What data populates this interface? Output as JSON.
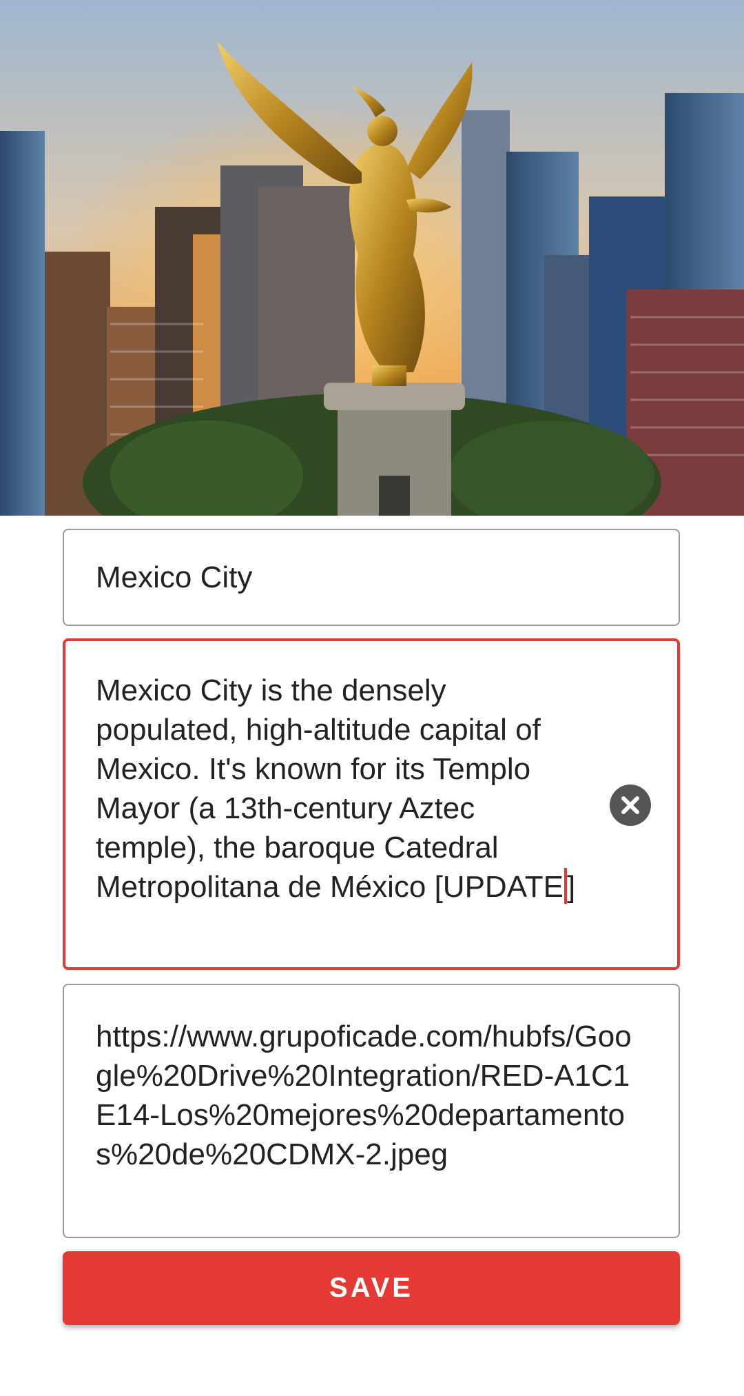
{
  "hero": {
    "image": "city-skyline-photo-with-golden-angel-statue"
  },
  "form": {
    "name_value": "Mexico City",
    "description_value": "Mexico City is the densely populated, high-altitude capital of Mexico. It's known for its Templo Mayor (a 13th-century Aztec temple), the baroque Catedral Metropolitana de México [UPDATE",
    "description_value_tail": "]",
    "url_value": "https://www.grupoficade.com/hubfs/Google%20Drive%20Integration/RED-A1C1E14-Los%20mejores%20departamentos%20de%20CDMX-2.jpeg",
    "clear_icon": "close-circle-icon",
    "save_label": "SAVE"
  },
  "colors": {
    "accent": "#e53935",
    "field_border": "#9a9a9a",
    "clear_icon_bg": "#555555"
  }
}
